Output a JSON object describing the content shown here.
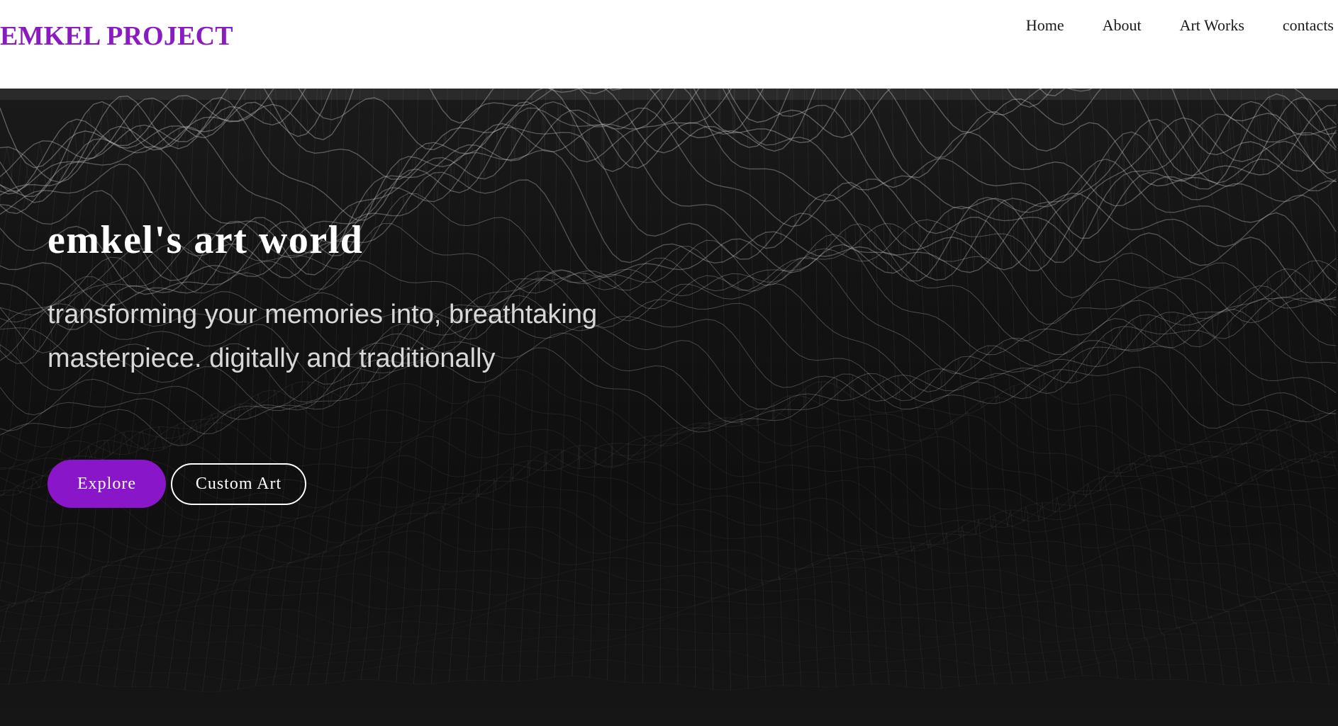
{
  "header": {
    "brand": "EMKEL PROJECT",
    "nav": [
      "Home",
      "About",
      "Art Works",
      "contacts"
    ]
  },
  "hero": {
    "title": "emkel's art world",
    "subtitle": "transforming your memories into, breathtaking masterpiece. digitally and traditionally",
    "buttons": {
      "explore": "Explore",
      "custom_art": "Custom Art"
    },
    "background_image": "wireframe-terrain"
  },
  "colors": {
    "brand": "#8a1bc2",
    "accent": "#8a16c9",
    "hero_background": "#121212",
    "hero_text": "#ffffff",
    "hero_subtext": "#d8d8d8"
  }
}
